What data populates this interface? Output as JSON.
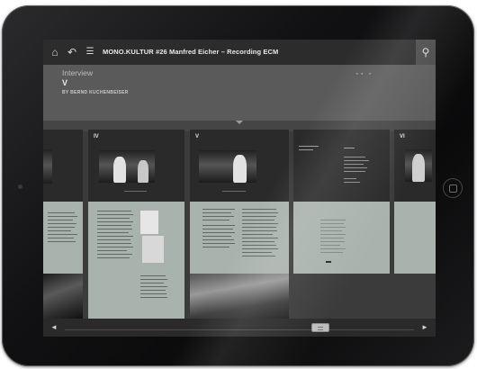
{
  "app": {
    "title": "MONO.KULTUR #26  Manfred Eicher – Recording ECM"
  },
  "toolbar": {
    "home_icon": "⌂",
    "back_icon": "↶",
    "menu_icon": "☰",
    "settings_icon": "⚲"
  },
  "section": {
    "label": "Interview",
    "numeral": "V",
    "byline": "BY BERND KUCHENBEISER",
    "mini_nav": "◂◂ ▸"
  },
  "pages": [
    {
      "numeral": ""
    },
    {
      "numeral": "IV"
    },
    {
      "numeral": "V"
    },
    {
      "numeral": ""
    },
    {
      "numeral": "VI"
    }
  ],
  "bottom_bar": {
    "prev_label": "◄",
    "next_label": "►"
  }
}
